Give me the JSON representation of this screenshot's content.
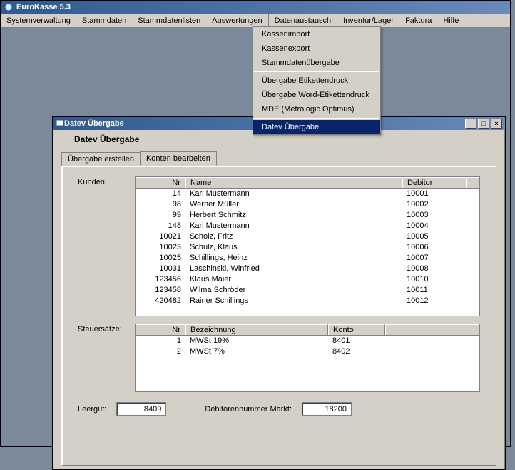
{
  "app": {
    "title": "EuroKasse 5.3"
  },
  "menubar": {
    "items": [
      "Systemverwaltung",
      "Stammdaten",
      "Stammdatenlisten",
      "Auswertungen",
      "Datenaustausch",
      "Inventur/Lager",
      "Faktura",
      "Hilfe"
    ],
    "open_index": 4
  },
  "dropdown": {
    "groups": [
      [
        "Kassenimport",
        "Kassenexport",
        "Stammdatenübergabe"
      ],
      [
        "Übergabe Etikettendruck",
        "Übergabe Word-Etikettendruck",
        "MDE (Metrologic Optimus)"
      ],
      [
        "Datev Übergabe"
      ]
    ],
    "highlighted": "Datev Übergabe"
  },
  "child_window": {
    "title": "Datev Übergabe",
    "heading": "Datev Übergabe",
    "tabs": [
      "Übergabe erstellen",
      "Konten bearbeiten"
    ],
    "active_tab": 1,
    "labels": {
      "kunden": "Kunden:",
      "steuersaetze": "Steuersätze:",
      "leergut": "Leergut:",
      "debitor_markt": "Debitorennummer Markt:"
    },
    "kunden": {
      "headers": {
        "nr": "Nr",
        "name": "Name",
        "debitor": "Debitor"
      },
      "rows": [
        {
          "nr": "14",
          "name": "Karl Mustermann",
          "debitor": "10001"
        },
        {
          "nr": "98",
          "name": "Werner Müller",
          "debitor": "10002"
        },
        {
          "nr": "99",
          "name": "Herbert Schmitz",
          "debitor": "10003"
        },
        {
          "nr": "148",
          "name": "Karl Mustermann",
          "debitor": "10004"
        },
        {
          "nr": "10021",
          "name": "Scholz, Fritz",
          "debitor": "10005"
        },
        {
          "nr": "10023",
          "name": "Schulz, Klaus",
          "debitor": "10006"
        },
        {
          "nr": "10025",
          "name": "Schillings, Heinz",
          "debitor": "10007"
        },
        {
          "nr": "10031",
          "name": "Laschinski, Winfried",
          "debitor": "10008"
        },
        {
          "nr": "123456",
          "name": "Klaus Maier",
          "debitor": "10010"
        },
        {
          "nr": "123458",
          "name": "Wilma Schröder",
          "debitor": "10011"
        },
        {
          "nr": "420482",
          "name": "Rainer Schillings",
          "debitor": "10012"
        }
      ]
    },
    "steuersaetze": {
      "headers": {
        "nr": "Nr",
        "bezeichnung": "Bezeichnung",
        "konto": "Konto"
      },
      "rows": [
        {
          "nr": "1",
          "bezeichnung": "MWSt 19%",
          "konto": "8401"
        },
        {
          "nr": "2",
          "bezeichnung": "MWSt 7%",
          "konto": "8402"
        }
      ]
    },
    "leergut_value": "8409",
    "debitor_markt_value": "18200"
  }
}
